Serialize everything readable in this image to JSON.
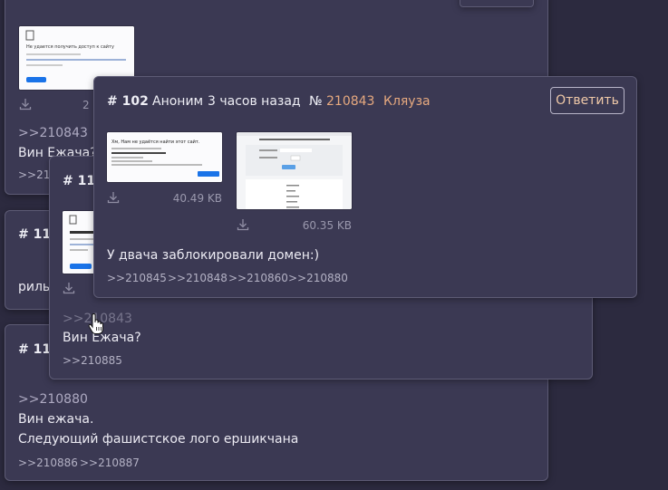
{
  "back_post_top": {
    "file_size": "2",
    "reply_link": ">>210843",
    "text": "Вин Ежача?",
    "reply_footer": ">>210"
  },
  "post_111": {
    "number": "# 111",
    "text_fragment": "рилы"
  },
  "post_112": {
    "number": "# 112",
    "quote_link": ">>210880",
    "lines": [
      "Вин ежача.",
      "Следующий фашистское лого ершикчана"
    ],
    "replies": [
      ">>210886",
      ">>210887"
    ]
  },
  "popup_110": {
    "number": "# 110",
    "quote_link": ">>210843",
    "text": "Вин Ежача?",
    "replies": [
      ">>210885"
    ]
  },
  "popup_102": {
    "number": "# 102",
    "author": "Аноним",
    "time": "3 часов назад",
    "id_prefix": "№",
    "id": "210843",
    "flag": "Кляуза",
    "reply_button": "Ответить",
    "files": [
      {
        "size": "40.49 KB",
        "thumb_title": "Хм, Нам не удаётся найти этот сайт."
      },
      {
        "size": "60.35 KB",
        "thumb_title": ""
      }
    ],
    "text": "У двача заблокировали домен:)",
    "replies": [
      ">>210845",
      ">>210848",
      ">>210860",
      ">>210880"
    ]
  },
  "thumb_texts": {
    "error_title": "Не удается получить доступ к сайту",
    "reload": "Перезагрузить"
  },
  "colors": {
    "background": "#2c2a3f",
    "card": "#3b3953",
    "accent_orange": "#e6a97f",
    "link": "#b4b2c6"
  }
}
